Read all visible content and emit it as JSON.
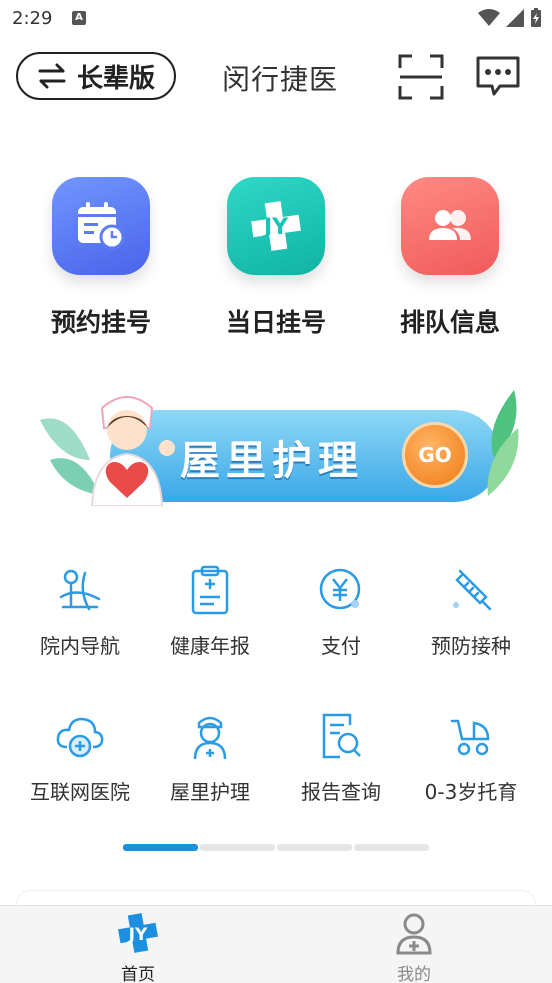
{
  "status": {
    "time": "2:29",
    "notice_glyph": "A"
  },
  "header": {
    "elder_mode_label": "长辈版",
    "title": "闵行捷医"
  },
  "quick_actions": [
    {
      "label": "预约挂号",
      "icon": "calendar-clock-icon",
      "color": "#5b7cf5"
    },
    {
      "label": "当日挂号",
      "icon": "jy-logo-icon",
      "color": "#18c4b4"
    },
    {
      "label": "排队信息",
      "icon": "people-icon",
      "color": "#f86b6b"
    }
  ],
  "banner": {
    "title": "屋里护理",
    "go_label": "GO"
  },
  "services": [
    {
      "label": "院内导航",
      "icon": "navigation-map-icon"
    },
    {
      "label": "健康年报",
      "icon": "health-report-icon"
    },
    {
      "label": "支付",
      "icon": "yuan-payment-icon"
    },
    {
      "label": "预防接种",
      "icon": "syringe-icon"
    },
    {
      "label": "互联网医院",
      "icon": "cloud-hospital-icon"
    },
    {
      "label": "屋里护理",
      "icon": "nurse-icon"
    },
    {
      "label": "报告查询",
      "icon": "report-search-icon"
    },
    {
      "label": "0-3岁托育",
      "icon": "stroller-icon"
    }
  ],
  "bottom_nav": [
    {
      "label": "首页",
      "icon": "home-jy-icon",
      "active": true
    },
    {
      "label": "我的",
      "icon": "profile-icon",
      "active": false
    }
  ],
  "colors": {
    "accent": "#1d8fe0",
    "icon_blue": "#2a9be6",
    "nav_inactive": "#8a8a8a"
  }
}
